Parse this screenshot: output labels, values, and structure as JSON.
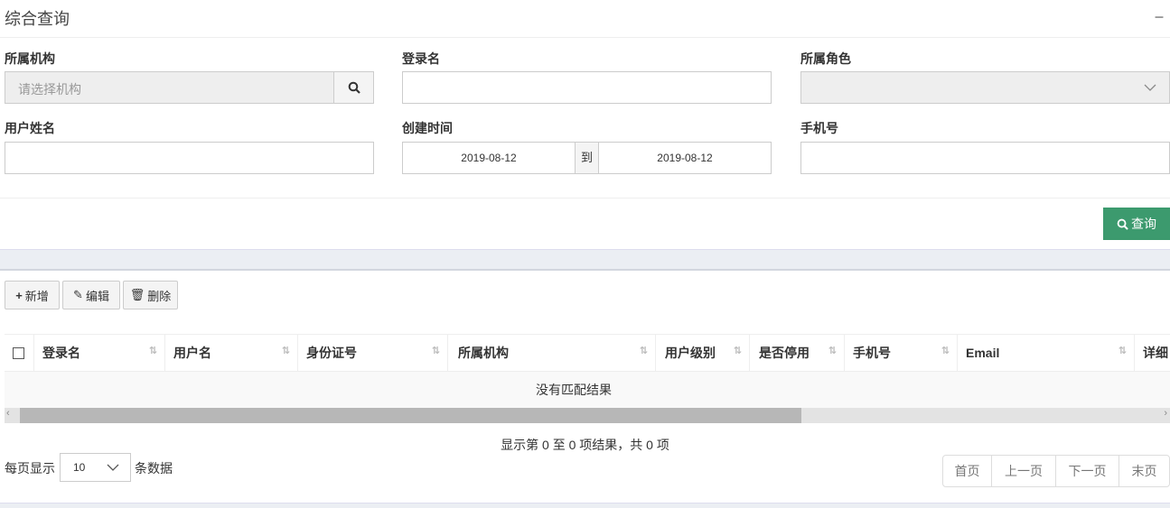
{
  "panel": {
    "title": "综合查询",
    "collapse_icon": "minus-icon"
  },
  "form": {
    "org": {
      "label": "所属机构",
      "placeholder": "请选择机构"
    },
    "login": {
      "label": "登录名",
      "value": ""
    },
    "role": {
      "label": "所属角色",
      "value": ""
    },
    "realname": {
      "label": "用户姓名",
      "value": ""
    },
    "created": {
      "label": "创建时间",
      "from": "2019-08-12",
      "sep": "到",
      "to": "2019-08-12"
    },
    "phone": {
      "label": "手机号",
      "value": ""
    },
    "search": "查询"
  },
  "toolbar": {
    "add": "新增",
    "edit": "编辑",
    "delete": "删除"
  },
  "table": {
    "columns": [
      "登录名",
      "用户名",
      "身份证号",
      "所属机构",
      "用户级别",
      "是否停用",
      "手机号",
      "Email",
      "详细"
    ],
    "empty": "没有匹配结果"
  },
  "pagination": {
    "summary": "显示第 0 至 0 项结果，共 0 项",
    "per_page_prefix": "每页显示",
    "per_page": "10",
    "per_page_suffix": "条数据",
    "first": "首页",
    "prev": "上一页",
    "next": "下一页",
    "last": "末页"
  },
  "colors": {
    "primary": "#3c9a6e"
  }
}
